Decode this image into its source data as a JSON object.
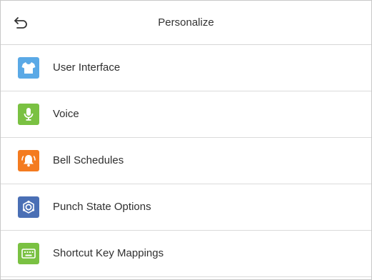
{
  "header": {
    "title": "Personalize"
  },
  "menu": {
    "items": [
      {
        "label": "User Interface",
        "icon": "shirt-icon",
        "color": "#5aa9e6"
      },
      {
        "label": "Voice",
        "icon": "microphone-icon",
        "color": "#7ac142"
      },
      {
        "label": "Bell Schedules",
        "icon": "bell-icon",
        "color": "#f47b20"
      },
      {
        "label": "Punch State Options",
        "icon": "punch-state-icon",
        "color": "#4a6fb5"
      },
      {
        "label": "Shortcut Key Mappings",
        "icon": "keyboard-icon",
        "color": "#7ac142"
      }
    ]
  }
}
